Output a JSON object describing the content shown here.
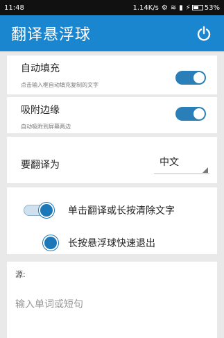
{
  "status_bar": {
    "time": "11:48",
    "speed": "1.14K/s",
    "battery": "53%",
    "battery_level": 0.53
  },
  "app_bar": {
    "title": "翻译悬浮球",
    "power_icon": "power-icon",
    "color": "#1a86cf"
  },
  "settings": {
    "auto_fill": {
      "title": "自动填充",
      "subtitle": "点击输入框自动填充复制的文字",
      "enabled": true
    },
    "snap_edge": {
      "title": "吸附边缘",
      "subtitle": "自动吸附到屏幕两边",
      "enabled": true
    }
  },
  "translate_to": {
    "label": "要翻译为",
    "selected": "中文"
  },
  "modes": {
    "tap_mode": {
      "label": "单击翻译或长按清除文字",
      "enabled": true
    },
    "longpress_mode": {
      "label": "长按悬浮球快速退出",
      "selected": true
    }
  },
  "source": {
    "label": "源:",
    "placeholder": "输入单词或短句",
    "value": ""
  }
}
